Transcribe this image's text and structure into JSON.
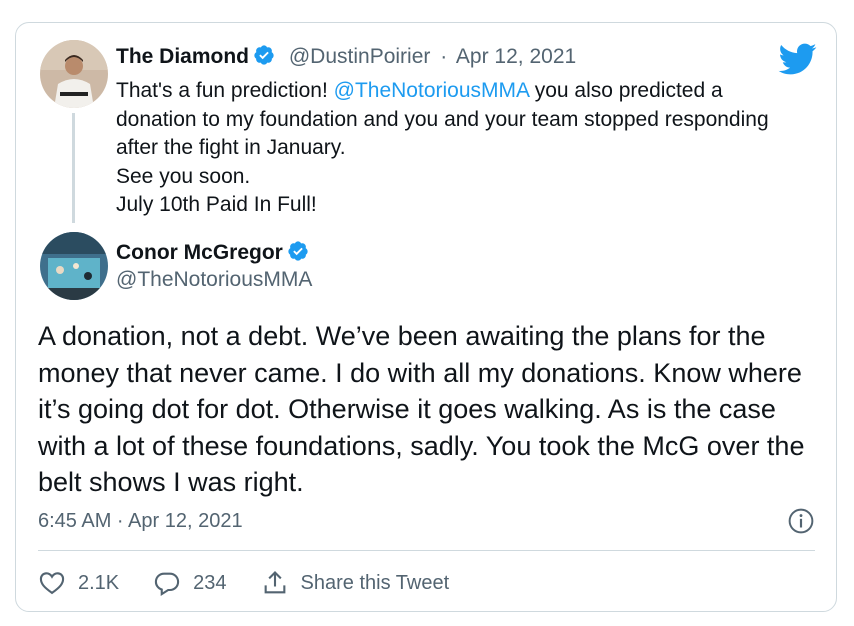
{
  "quoted": {
    "display_name": "The Diamond",
    "handle": "@DustinPoirier",
    "separator": "·",
    "date": "Apr 12, 2021",
    "text_before_mention": "That's a fun prediction! ",
    "mention": "@TheNotoriousMMA",
    "text_after_mention": " you also predicted a donation to my foundation and you and your team stopped responding after the fight in January.",
    "line2": "See you soon.",
    "line3": "July 10th Paid In Full!"
  },
  "main": {
    "display_name": "Conor McGregor",
    "handle": "@TheNotoriousMMA",
    "text": "A donation, not a debt. We’ve been awaiting the plans for the money that never came. I do with all my donations. Know where it’s going dot for dot. Otherwise it goes walking. As is the case with a lot of these foundations, sadly. You took the McG over the belt shows I was right.",
    "timestamp": "6:45 AM · Apr 12, 2021"
  },
  "actions": {
    "likes": "2.1K",
    "replies": "234",
    "share_label": "Share this Tweet"
  },
  "icons": {
    "verified": "verified-badge-icon",
    "brand": "twitter-bird-icon",
    "info": "info-icon",
    "like": "heart-icon",
    "reply": "reply-icon",
    "share": "share-icon"
  },
  "colors": {
    "accent": "#1d9bf0",
    "text": "#0f1419",
    "muted": "#536471",
    "border": "#cfd9de"
  }
}
